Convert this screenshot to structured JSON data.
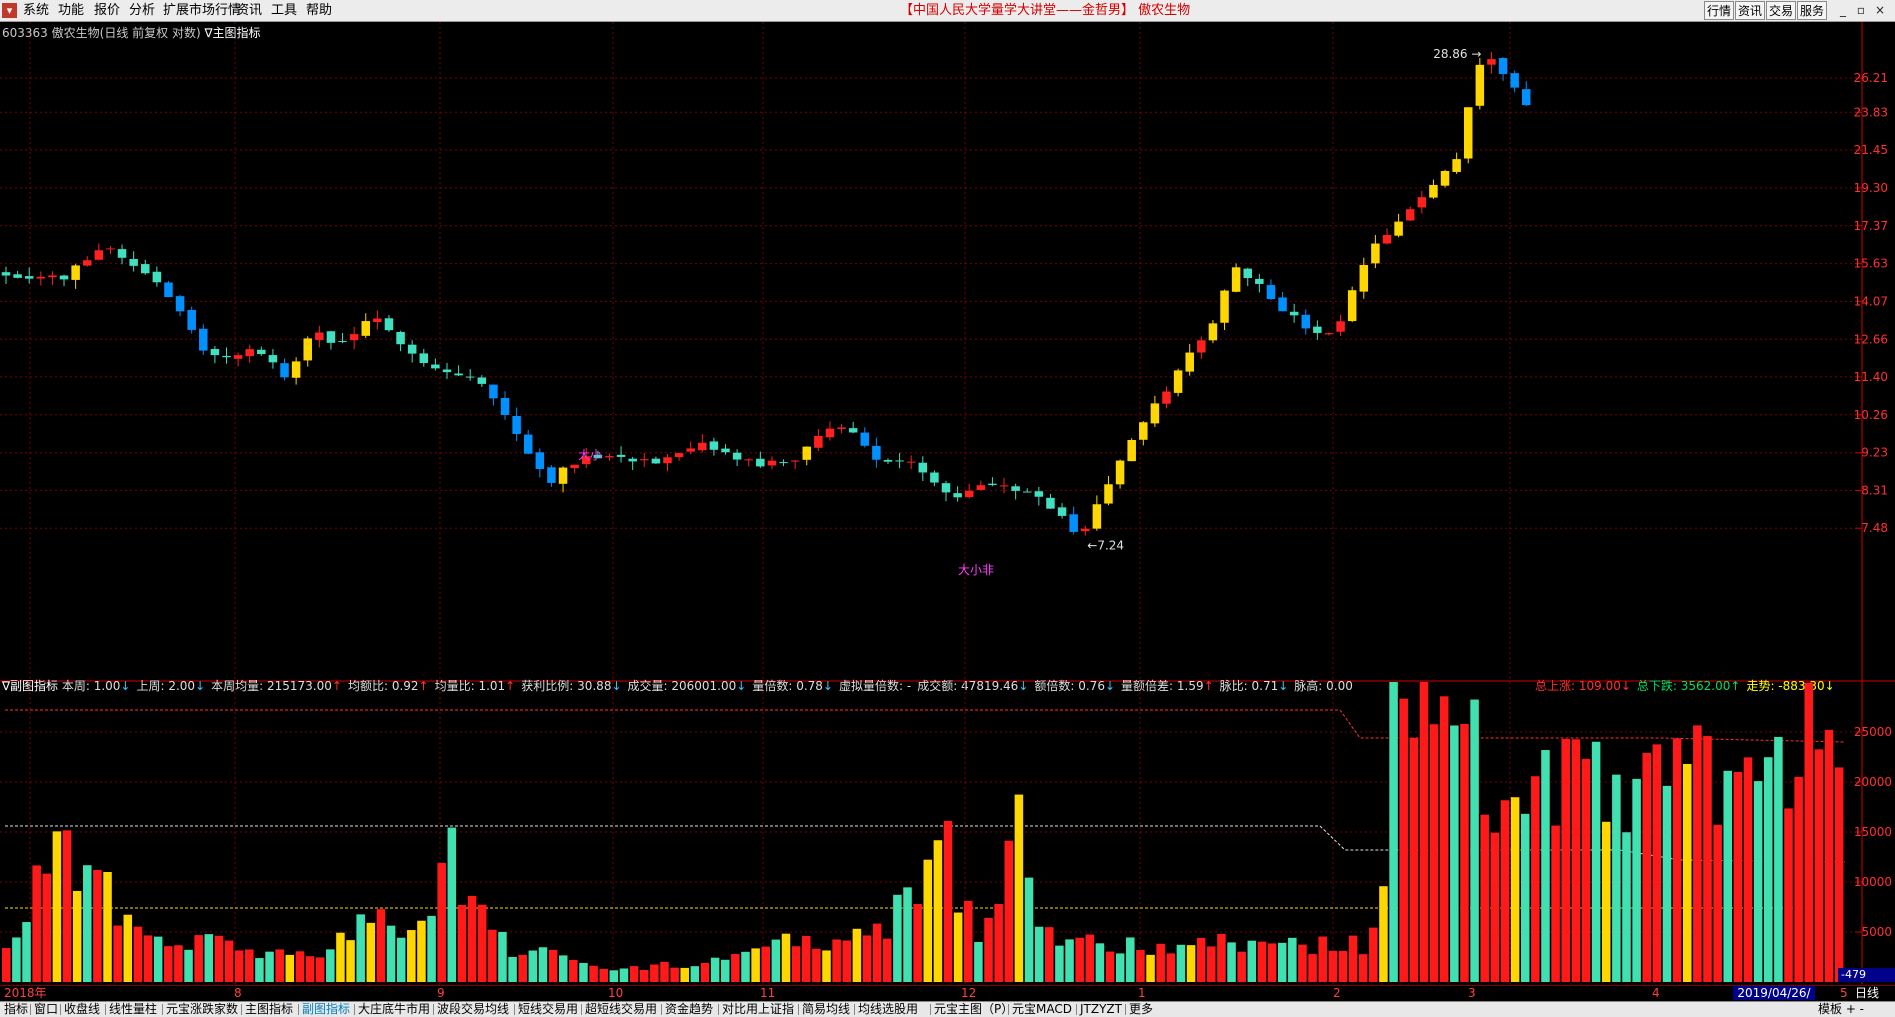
{
  "menubar": {
    "items": [
      "系统",
      "功能",
      "报价",
      "分析",
      "扩展市场行情",
      "资讯",
      "工具",
      "帮助"
    ],
    "title": "【中国人民大学量学大讲堂——金哲男】 傲农生物",
    "buttons": [
      "行情",
      "资讯",
      "交易",
      "服务"
    ],
    "controls": [
      "_",
      "▫",
      "×"
    ]
  },
  "price_header": {
    "code": "603363",
    "text": "傲农生物(日线 前复权 对数)",
    "indicator": "∇主图指标"
  },
  "price_chart": {
    "scale": "log",
    "ylim": [
      7.0,
      29.8
    ],
    "ticks": [
      26.21,
      23.83,
      21.45,
      19.3,
      17.37,
      15.63,
      14.07,
      12.66,
      11.4,
      10.26,
      9.23,
      8.31,
      7.48
    ],
    "tick_labels": [
      "26.21",
      "23.83",
      "21.45",
      "19.30",
      "17.37",
      "15.63",
      "14.07",
      "12.66",
      "11.40",
      "10.26",
      "9.23",
      "8.31",
      "7.48"
    ],
    "high_label": "28.86",
    "low_label": "7.24",
    "annotations": [
      "大小",
      "大小非"
    ],
    "colors": {
      "up": "#ff2020",
      "down": "#40e0c0",
      "strong_up": "#ffd700",
      "strong_down": "#0090ff",
      "grid": "#7a0000",
      "axis": "#d00000"
    },
    "anchors": [
      [
        0,
        15.2
      ],
      [
        15,
        15.0
      ],
      [
        25,
        16.5
      ],
      [
        40,
        14.8
      ],
      [
        52,
        12.0
      ],
      [
        65,
        12.3
      ],
      [
        72,
        11.4
      ],
      [
        80,
        13.0
      ],
      [
        85,
        12.4
      ],
      [
        95,
        13.4
      ],
      [
        110,
        11.7
      ],
      [
        122,
        11.3
      ],
      [
        128,
        10.4
      ],
      [
        140,
        8.5
      ],
      [
        150,
        9.2
      ],
      [
        170,
        9.0
      ],
      [
        180,
        9.4
      ],
      [
        195,
        8.9
      ],
      [
        205,
        9.1
      ],
      [
        215,
        10.1
      ],
      [
        225,
        9.1
      ],
      [
        235,
        8.9
      ],
      [
        245,
        8.2
      ],
      [
        255,
        8.5
      ],
      [
        265,
        8.3
      ],
      [
        278,
        7.3
      ],
      [
        285,
        8.5
      ],
      [
        300,
        11.0
      ],
      [
        312,
        13.3
      ],
      [
        318,
        15.6
      ],
      [
        332,
        13.5
      ],
      [
        340,
        12.7
      ],
      [
        345,
        13.2
      ],
      [
        352,
        16.0
      ],
      [
        365,
        18.5
      ],
      [
        375,
        21.0
      ],
      [
        382,
        28.5
      ],
      [
        395,
        23.5
      ]
    ],
    "count": 395
  },
  "indicator_header": {
    "name": "∇副图指标",
    "items": [
      {
        "label": "本周:",
        "value": "1.00",
        "arrow": "↓",
        "cls": "dn"
      },
      {
        "label": "上周:",
        "value": "2.00",
        "arrow": "↓",
        "cls": "dn"
      },
      {
        "label": "本周均量:",
        "value": "215173.00",
        "arrow": "↑",
        "cls": "up"
      },
      {
        "label": "均额比:",
        "value": "0.92",
        "arrow": "↑",
        "cls": "up"
      },
      {
        "label": "均量比:",
        "value": "1.01",
        "arrow": "↑",
        "cls": "up"
      },
      {
        "label": "获利比例:",
        "value": "30.88",
        "arrow": "↓",
        "cls": "dn"
      },
      {
        "label": "成交量:",
        "value": "206001.00",
        "arrow": "↓",
        "cls": "dn"
      },
      {
        "label": "量倍数:",
        "value": "0.78",
        "arrow": "↓",
        "cls": "dn"
      },
      {
        "label": "虚拟量倍数:",
        "value": "-",
        "arrow": "",
        "cls": ""
      },
      {
        "label": "成交额:",
        "value": "47819.46",
        "arrow": "↓",
        "cls": "dn"
      },
      {
        "label": "额倍数:",
        "value": "0.76",
        "arrow": "↓",
        "cls": "dn"
      },
      {
        "label": "量额倍差:",
        "value": "1.59",
        "arrow": "↑",
        "cls": "up"
      },
      {
        "label": "脉比:",
        "value": "0.71",
        "arrow": "↓",
        "cls": "dn"
      },
      {
        "label": "脉高:",
        "value": "0.00",
        "arrow": "",
        "cls": ""
      }
    ],
    "right": [
      {
        "label": "总上涨:",
        "value": "109.00",
        "arrow": "↓",
        "cls": "up"
      },
      {
        "label": "总下跌:",
        "value": "3562.00",
        "arrow": "↑",
        "cls": "gr"
      },
      {
        "label": "走势:",
        "value": "-883.30",
        "arrow": "↓",
        "cls": "yl"
      }
    ]
  },
  "volume_chart": {
    "ylim": [
      0,
      29000
    ],
    "ticks": [
      25000,
      20000,
      15000,
      10000,
      5000
    ],
    "tick_labels": [
      "25000",
      "20000",
      "15000",
      "10000",
      "5000"
    ],
    "cursor_label": "-479",
    "anchors": [
      [
        0,
        4000
      ],
      [
        4,
        12500
      ],
      [
        8,
        12000
      ],
      [
        11,
        7000
      ],
      [
        14,
        4500
      ],
      [
        20,
        3800
      ],
      [
        24,
        3200
      ],
      [
        28,
        3000
      ],
      [
        32,
        3200
      ],
      [
        36,
        7000
      ],
      [
        40,
        5200
      ],
      [
        44,
        12000
      ],
      [
        47,
        6000
      ],
      [
        50,
        3200
      ],
      [
        56,
        2200
      ],
      [
        62,
        1400
      ],
      [
        66,
        1800
      ],
      [
        72,
        2600
      ],
      [
        76,
        4800
      ],
      [
        82,
        3900
      ],
      [
        86,
        4500
      ],
      [
        90,
        9500
      ],
      [
        92,
        17000
      ],
      [
        94,
        8000
      ],
      [
        96,
        4500
      ],
      [
        100,
        14500
      ],
      [
        102,
        5000
      ],
      [
        104,
        4000
      ],
      [
        112,
        3500
      ],
      [
        122,
        4000
      ],
      [
        132,
        3700
      ],
      [
        134,
        3600
      ],
      [
        136,
        10000
      ],
      [
        137,
        27000
      ],
      [
        143,
        23000
      ],
      [
        150,
        19000
      ],
      [
        155,
        20000
      ],
      [
        160,
        17000
      ],
      [
        165,
        21000
      ],
      [
        168,
        20000
      ],
      [
        175,
        19500
      ],
      [
        178,
        27000
      ],
      [
        182,
        19000
      ]
    ],
    "count": 182
  },
  "date_axis": {
    "labels": [
      "2018年",
      "8",
      "9",
      "10",
      "11",
      "12",
      "1",
      "2",
      "3",
      "4",
      "5"
    ],
    "cursor_date": "2019/04/26/五",
    "period": "日线"
  },
  "tabs": {
    "items": [
      "指标",
      "窗口",
      "收盘线",
      "线性量柱",
      "元宝涨跌家数",
      "主图指标",
      "副图指标",
      "大庄底牛市用",
      "波段交易均线",
      "短线交易用",
      "超短线交易用",
      "资金趋势",
      "对比用上证指",
      "简易均线",
      "均线选股用",
      "元宝主图（P）",
      "元宝MACD",
      "JTZYZT",
      "更多"
    ],
    "active": "副图指标",
    "right_controls": "模板 + -"
  }
}
